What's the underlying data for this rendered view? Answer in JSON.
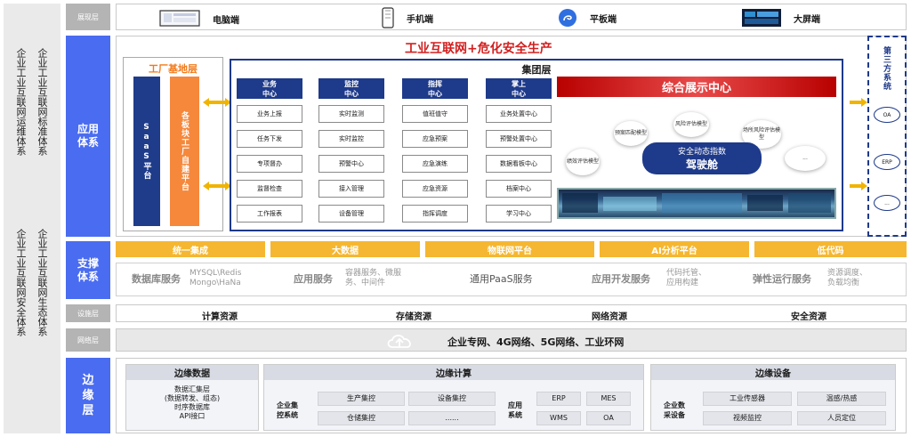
{
  "left": {
    "col1a": "企业工业互联网运维体系",
    "col1b": "企业工业互联网标准体系",
    "col2a": "企业工业互联网安全体系",
    "col2b": "企业工业互联网生态体系"
  },
  "layers": {
    "display": "展现层",
    "app": "应用\n体系",
    "support": "支撑\n体系",
    "infra": "设施层",
    "network": "网络层",
    "edge": "边\n缘\n层"
  },
  "display": {
    "items": [
      {
        "label": "电脑端",
        "icon": "monitor-icon"
      },
      {
        "label": "手机端",
        "icon": "phone-icon"
      },
      {
        "label": "平板端",
        "icon": "tablet-icon"
      },
      {
        "label": "大屏端",
        "icon": "big-screen-icon"
      }
    ]
  },
  "app": {
    "title": "工业互联网+危化安全生产",
    "factory_title": "工厂基地层",
    "saas": "SaaS平台",
    "selfbuild": "各板块工厂自建平台",
    "group_title": "集团层",
    "columns": [
      {
        "head": "业务\n中心",
        "cells": [
          "业务上报",
          "任务下发",
          "专项督办",
          "监督检查",
          "工作报表"
        ]
      },
      {
        "head": "监控\n中心",
        "cells": [
          "实时监测",
          "实时监控",
          "预警中心",
          "接入管理",
          "设备管理"
        ]
      },
      {
        "head": "指挥\n中心",
        "cells": [
          "值班值守",
          "应急预案",
          "应急演练",
          "应急资源",
          "指挥调度"
        ]
      },
      {
        "head": "掌上\n中心",
        "cells": [
          "业务处置中心",
          "预警处置中心",
          "数据看板中心",
          "档案中心",
          "学习中心"
        ]
      }
    ],
    "showcase_title": "综合展示中心",
    "bubbles": [
      "预案匹配模型",
      "风险评估模型",
      "场所风险评估模型",
      "绩效评估模型",
      "..."
    ],
    "center_line1": "安全动态指数",
    "center_line2": "驾驶舱",
    "third_title": "第三方系统",
    "third_items": [
      "OA",
      "ERP",
      "..."
    ]
  },
  "support": {
    "heads": [
      "统一集成",
      "大数据",
      "物联网平台",
      "AI分析平台",
      "低代码"
    ],
    "db_label": "数据库服务",
    "db_detail": "MYSQL\\Redis\nMongo\\HaNa",
    "app_label": "应用服务",
    "app_detail": "容器服务、微服\n务、中间件",
    "paas": "通用PaaS服务",
    "dev_label": "应用开发服务",
    "dev_detail": "代码托管、\n应用构建",
    "elastic_label": "弹性运行服务",
    "elastic_detail": "资源调度、\n负载均衡"
  },
  "infra": {
    "items": [
      "计算资源",
      "存储资源",
      "网络资源",
      "安全资源"
    ]
  },
  "network": {
    "text": "企业专网、4G网络、5G网络、工业环网",
    "icon": "cloud-upload-icon"
  },
  "edge": {
    "data_title": "边缘数据",
    "data_text": "数据汇集层\n(数据转发、组态)\n时序数据库\nAPI接口",
    "compute_title": "边缘计算",
    "ctrl_label": "企业集\n控系统",
    "ctrl_items": [
      "生产集控",
      "设备集控",
      "仓储集控",
      "......"
    ],
    "app_label": "应用\n系统",
    "app_items": [
      "ERP",
      "MES",
      "WMS",
      "OA"
    ],
    "device_title": "边缘设备",
    "device_label": "企业数\n采设备",
    "device_items": [
      "工业传感器",
      "温感/热感",
      "视频监控",
      "人员定位"
    ]
  }
}
